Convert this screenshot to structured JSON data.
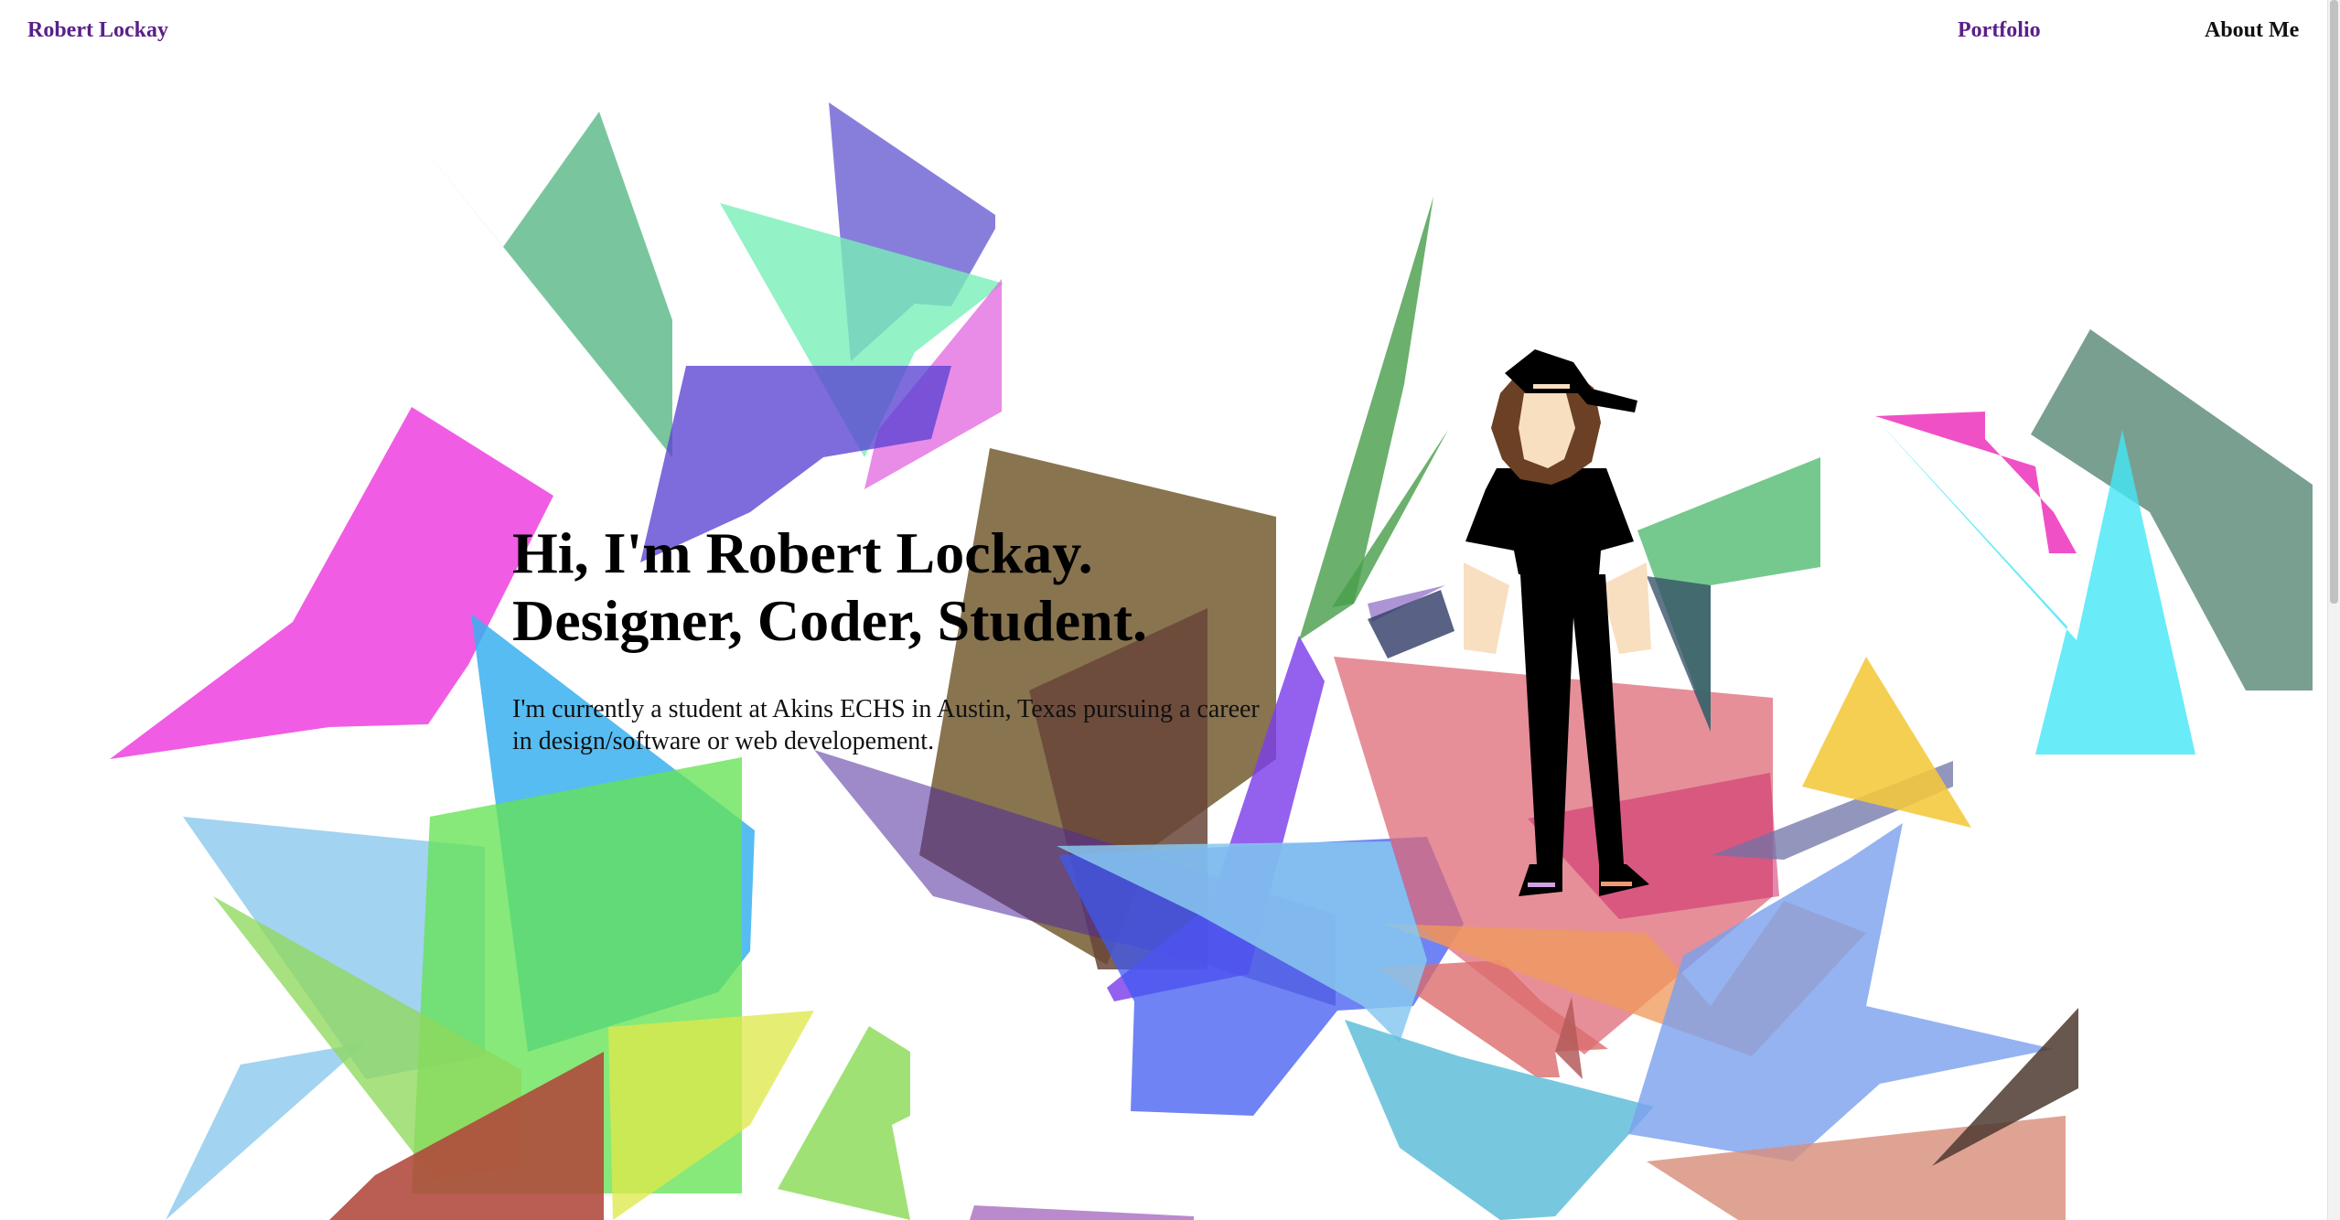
{
  "header": {
    "brand": "Robert Lockay",
    "nav": [
      {
        "label": "Portfolio"
      },
      {
        "label": "About Me"
      }
    ]
  },
  "hero": {
    "line1": "Hi, I'm Robert Lockay.",
    "line2": "Designer, Coder, Student.",
    "body": "I'm currently a student at Akins ECHS in Austin, Texas pursuing a career in design/software or web developement."
  },
  "colors": {
    "accent": "#5a1f8a",
    "text": "#111111",
    "background": "#ffffff"
  },
  "icons": {
    "avatar": "character-illustration",
    "background": "abstract-polygon-art"
  }
}
